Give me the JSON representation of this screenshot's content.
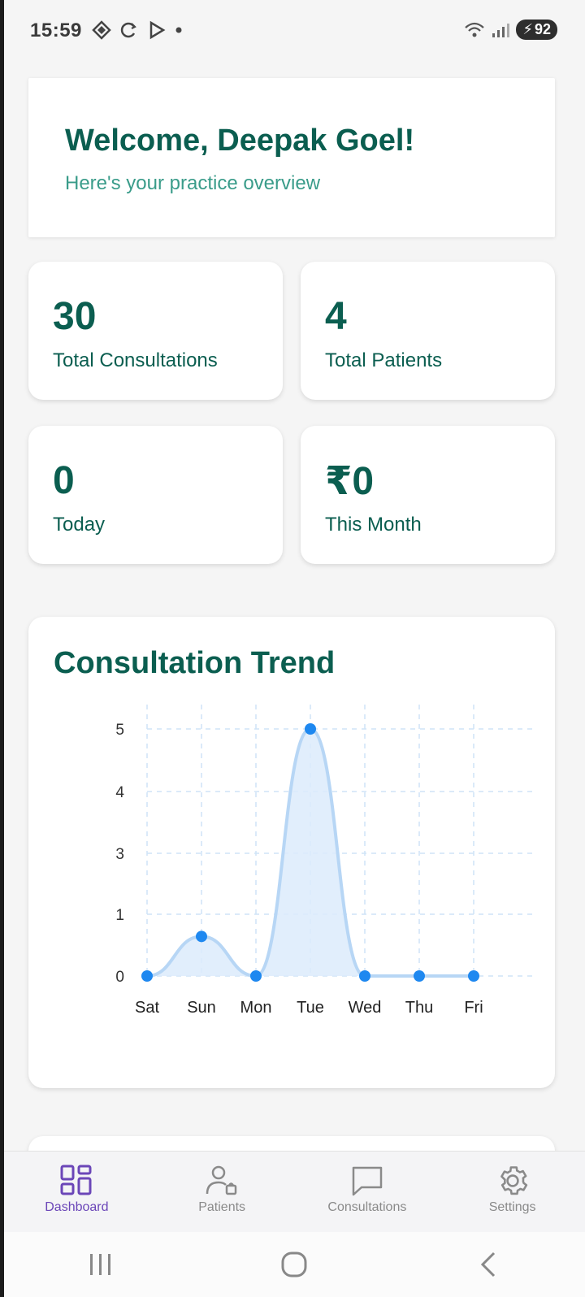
{
  "status_bar": {
    "time": "15:59",
    "battery": "92"
  },
  "welcome": {
    "title": "Welcome, Deepak Goel!",
    "subtitle": "Here's your practice overview"
  },
  "stats": [
    {
      "value": "30",
      "label": "Total Consultations"
    },
    {
      "value": "4",
      "label": "Total Patients"
    },
    {
      "value": "0",
      "label": "Today"
    },
    {
      "value": "₹0",
      "label": "This Month"
    }
  ],
  "chart_title": "Consultation Trend",
  "chart_data": {
    "type": "area",
    "title": "Consultation Trend",
    "categories": [
      "Sat",
      "Sun",
      "Mon",
      "Tue",
      "Wed",
      "Thu",
      "Fri"
    ],
    "values": [
      0,
      0.8,
      0,
      5,
      0,
      0,
      0
    ],
    "y_ticks": [
      "0",
      "1",
      "3",
      "4",
      "5"
    ],
    "ylim": [
      0,
      5
    ],
    "grid": true,
    "line_color": "#b7d6f5",
    "fill_color": "#dcebfb",
    "point_color": "#1e88f0"
  },
  "bottom_nav": {
    "items": [
      {
        "label": "Dashboard",
        "icon": "dashboard-icon",
        "active": true
      },
      {
        "label": "Patients",
        "icon": "patients-icon",
        "active": false
      },
      {
        "label": "Consultations",
        "icon": "chat-bubble-icon",
        "active": false
      },
      {
        "label": "Settings",
        "icon": "gear-icon",
        "active": false
      }
    ]
  },
  "colors": {
    "brand": "#0b5e50",
    "accent": "#3a9c8a",
    "nav_active": "#6b46b8"
  }
}
